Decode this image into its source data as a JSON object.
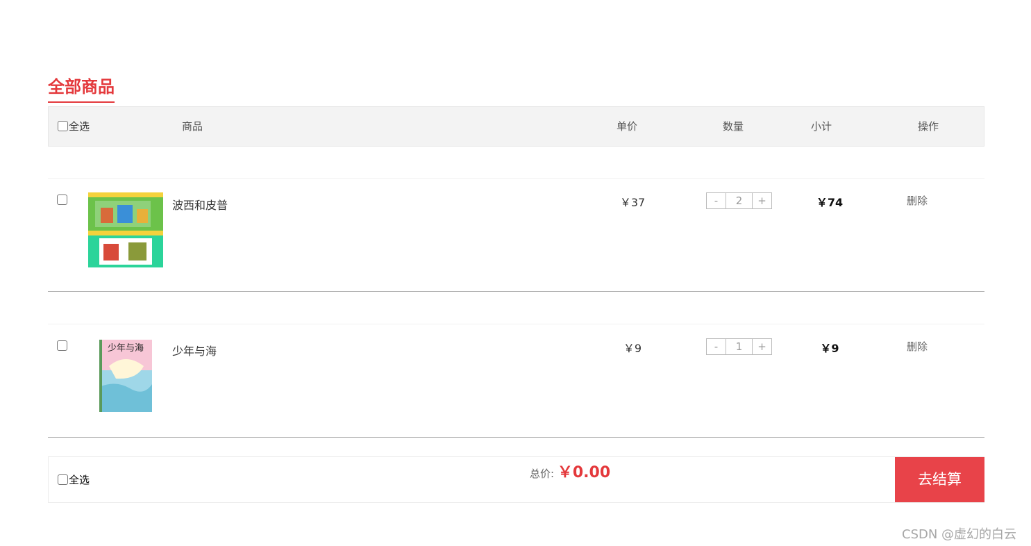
{
  "section_title": "全部商品",
  "header": {
    "select_all": "全选",
    "product": "商品",
    "unit_price": "单价",
    "quantity": "数量",
    "subtotal": "小计",
    "action": "操作"
  },
  "items": [
    {
      "name": "波西和皮普",
      "price": "￥37",
      "qty_minus": "-",
      "qty": "2",
      "qty_plus": "+",
      "subtotal": "￥74",
      "delete": "删除"
    },
    {
      "name": "少年与海",
      "price": "￥9",
      "qty_minus": "-",
      "qty": "1",
      "qty_plus": "+",
      "subtotal": "￥9",
      "delete": "删除",
      "cover_title": "少年与海"
    }
  ],
  "footer": {
    "select_all": "全选",
    "total_label": "总价:",
    "total_amount": "￥0.00",
    "checkout": "去结算"
  },
  "watermark": "CSDN @虚幻的白云",
  "colors": {
    "accent": "#e4393c",
    "checkout_bg": "#e84349",
    "header_bg": "#f3f3f3"
  }
}
